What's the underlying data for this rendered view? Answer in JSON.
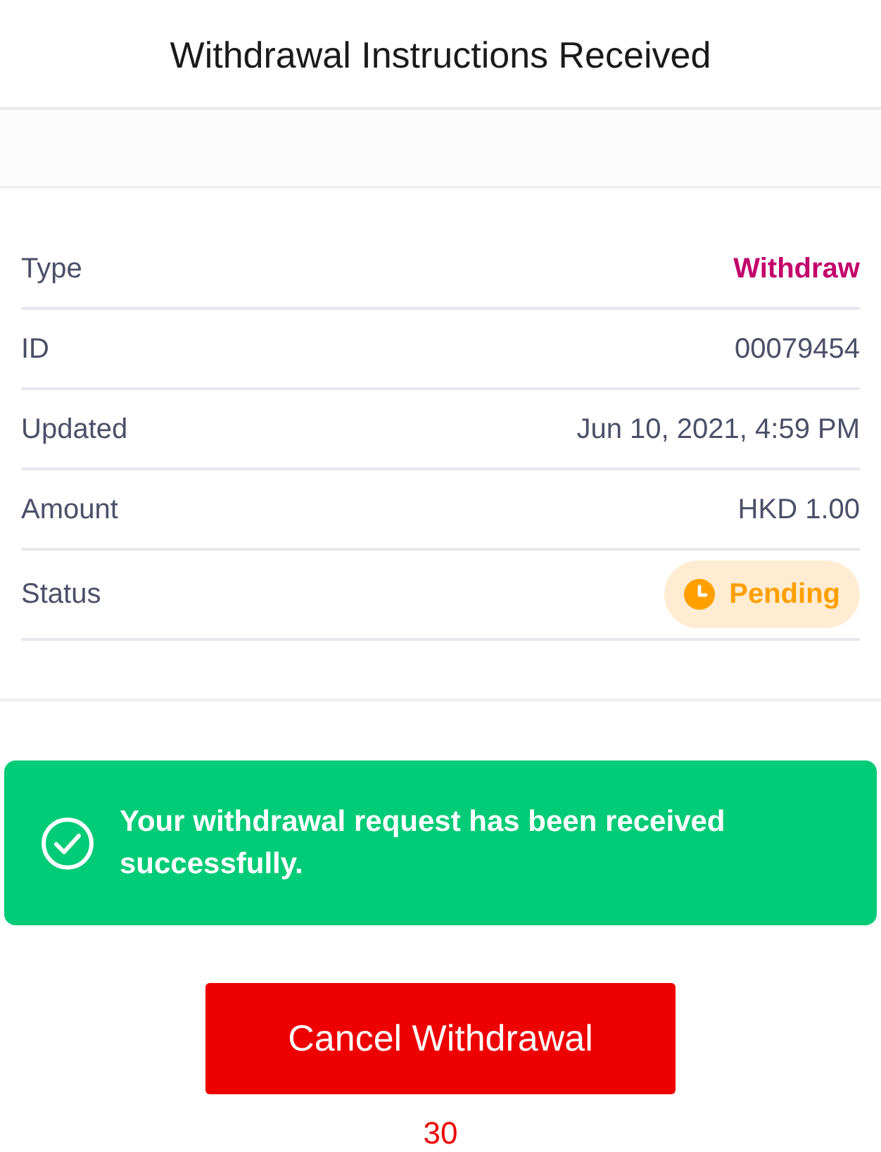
{
  "header": {
    "title": "Withdrawal Instructions Received"
  },
  "details": [
    {
      "label": "Type",
      "value": "Withdraw",
      "kind": "type"
    },
    {
      "label": "ID",
      "value": "00079454",
      "kind": "text"
    },
    {
      "label": "Updated",
      "value": "Jun 10, 2021, 4:59 PM",
      "kind": "text"
    },
    {
      "label": "Amount",
      "value": "HKD 1.00",
      "kind": "text"
    },
    {
      "label": "Status",
      "value": "Pending",
      "kind": "status"
    }
  ],
  "banner": {
    "message": "Your withdrawal request has been received successfully."
  },
  "cancel_button": {
    "label": "Cancel Withdrawal"
  },
  "countdown": "30"
}
